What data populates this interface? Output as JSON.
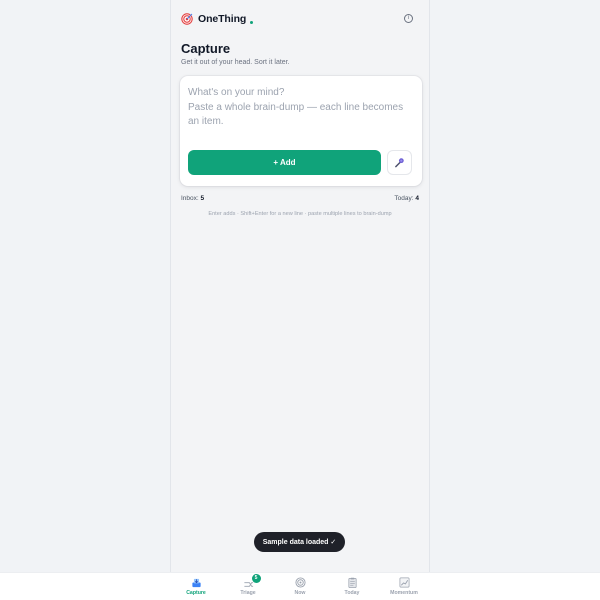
{
  "app": {
    "brand": "OneThing",
    "accent_color": "#10a37a",
    "info_icon": "info-circle-icon"
  },
  "capture": {
    "title": "Capture",
    "subtitle": "Get it out of your head. Sort it later.",
    "placeholder": "What's on your mind?\nPaste a whole brain-dump — each line becomes an item.",
    "value": "",
    "add_label": "+ Add",
    "mic_icon": "microphone-icon"
  },
  "counts": {
    "inbox_label": "Inbox:",
    "inbox_value": "5",
    "today_label": "Today:",
    "today_value": "4"
  },
  "hint": "Enter adds · Shift+Enter for a new line · paste multiple lines to brain-dump",
  "toast": "Sample data loaded ✓",
  "tabs": [
    {
      "label": "Capture",
      "icon": "inbox-tray-icon",
      "active": true
    },
    {
      "label": "Triage",
      "icon": "shuffle-icon",
      "badge": "5"
    },
    {
      "label": "Now",
      "icon": "target-icon"
    },
    {
      "label": "Today",
      "icon": "clipboard-icon"
    },
    {
      "label": "Momentum",
      "icon": "chart-up-icon"
    }
  ]
}
